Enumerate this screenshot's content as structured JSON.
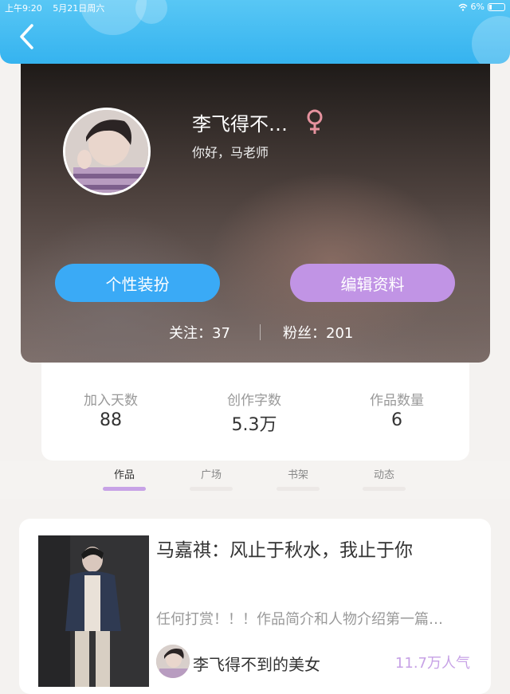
{
  "status_bar": {
    "time": "上午9:20",
    "date": "5月21日周六",
    "battery": "6%"
  },
  "profile": {
    "username": "李飞得不…",
    "gender": "female",
    "signature": "你好，马老师",
    "outfit_button": "个性装扮",
    "edit_button": "编辑资料",
    "follow": "关注：37",
    "fans": "粉丝：201",
    "colors": {
      "outfit": "#3aaaf6",
      "edit": "#c194e5",
      "gender": "#e6929e"
    }
  },
  "stats": {
    "days_label": "加入天数",
    "days_value": "88",
    "words_label": "创作字数",
    "words_value": "5.3万",
    "works_label": "作品数量",
    "works_value": "6"
  },
  "tabs": [
    {
      "label": "作品",
      "active": true
    },
    {
      "label": "广场",
      "active": false
    },
    {
      "label": "书架",
      "active": false
    },
    {
      "label": "动态",
      "active": false
    }
  ],
  "work": {
    "title": "马嘉祺：风止于秋水，我止于你",
    "description": "任何打赏！！！作品简介和人物介绍第一篇…",
    "author": "李飞得不到的美女",
    "popularity": "11.7万人气"
  }
}
